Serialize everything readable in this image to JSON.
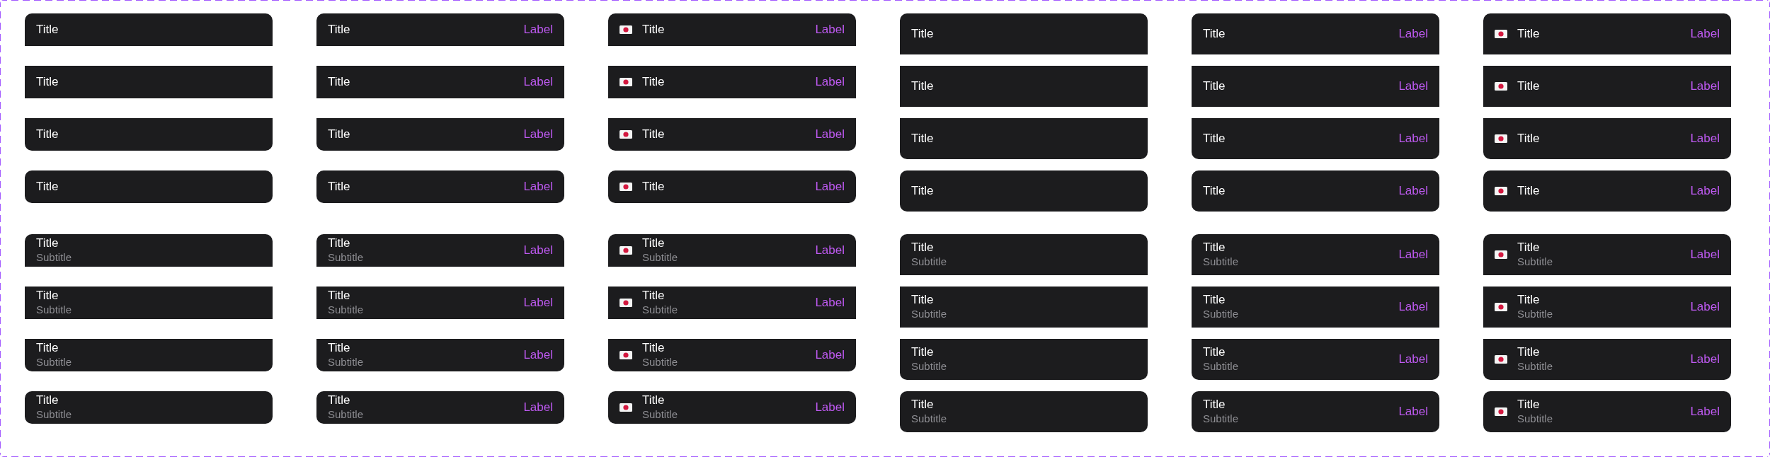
{
  "sections": [
    {
      "rows": [
        {
          "cells": [
            {
              "kind": "plain",
              "tall": false,
              "rounded_top": true,
              "rounded_bottom": false,
              "title": "Title"
            },
            {
              "kind": "plain",
              "tall": false,
              "rounded_top": true,
              "rounded_bottom": false,
              "title": "Title",
              "label": "Label"
            },
            {
              "kind": "flag",
              "tall": false,
              "rounded_top": true,
              "rounded_bottom": false,
              "title": "Title",
              "label": "Label"
            },
            {
              "kind": "plain",
              "tall": true,
              "rounded_top": true,
              "rounded_bottom": false,
              "title": "Title"
            },
            {
              "kind": "plain",
              "tall": true,
              "rounded_top": true,
              "rounded_bottom": false,
              "title": "Title",
              "label": "Label"
            },
            {
              "kind": "flag",
              "tall": true,
              "rounded_top": true,
              "rounded_bottom": false,
              "title": "Title",
              "label": "Label"
            }
          ]
        },
        {
          "cells": [
            {
              "kind": "plain",
              "tall": false,
              "rounded_top": false,
              "rounded_bottom": false,
              "title": "Title"
            },
            {
              "kind": "plain",
              "tall": false,
              "rounded_top": false,
              "rounded_bottom": false,
              "title": "Title",
              "label": "Label"
            },
            {
              "kind": "flag",
              "tall": false,
              "rounded_top": false,
              "rounded_bottom": false,
              "title": "Title",
              "label": "Label"
            },
            {
              "kind": "plain",
              "tall": true,
              "rounded_top": false,
              "rounded_bottom": false,
              "title": "Title"
            },
            {
              "kind": "plain",
              "tall": true,
              "rounded_top": false,
              "rounded_bottom": false,
              "title": "Title",
              "label": "Label"
            },
            {
              "kind": "flag",
              "tall": true,
              "rounded_top": false,
              "rounded_bottom": false,
              "title": "Title",
              "label": "Label"
            }
          ]
        },
        {
          "cells": [
            {
              "kind": "plain",
              "tall": false,
              "rounded_top": false,
              "rounded_bottom": true,
              "title": "Title"
            },
            {
              "kind": "plain",
              "tall": false,
              "rounded_top": false,
              "rounded_bottom": true,
              "title": "Title",
              "label": "Label"
            },
            {
              "kind": "flag",
              "tall": false,
              "rounded_top": false,
              "rounded_bottom": true,
              "title": "Title",
              "label": "Label"
            },
            {
              "kind": "plain",
              "tall": true,
              "rounded_top": false,
              "rounded_bottom": true,
              "title": "Title"
            },
            {
              "kind": "plain",
              "tall": true,
              "rounded_top": false,
              "rounded_bottom": true,
              "title": "Title",
              "label": "Label"
            },
            {
              "kind": "flag",
              "tall": true,
              "rounded_top": false,
              "rounded_bottom": true,
              "title": "Title",
              "label": "Label"
            }
          ]
        },
        {
          "cells": [
            {
              "kind": "plain",
              "tall": false,
              "rounded_top": true,
              "rounded_bottom": true,
              "title": "Title"
            },
            {
              "kind": "plain",
              "tall": false,
              "rounded_top": true,
              "rounded_bottom": true,
              "title": "Title",
              "label": "Label"
            },
            {
              "kind": "flag",
              "tall": false,
              "rounded_top": true,
              "rounded_bottom": true,
              "title": "Title",
              "label": "Label"
            },
            {
              "kind": "plain",
              "tall": true,
              "rounded_top": true,
              "rounded_bottom": true,
              "title": "Title"
            },
            {
              "kind": "plain",
              "tall": true,
              "rounded_top": true,
              "rounded_bottom": true,
              "title": "Title",
              "label": "Label"
            },
            {
              "kind": "flag",
              "tall": true,
              "rounded_top": true,
              "rounded_bottom": true,
              "title": "Title",
              "label": "Label"
            }
          ]
        }
      ]
    },
    {
      "rows": [
        {
          "cells": [
            {
              "kind": "plain",
              "tall": false,
              "rounded_top": true,
              "rounded_bottom": false,
              "title": "Title",
              "subtitle": "Subtitle"
            },
            {
              "kind": "plain",
              "tall": false,
              "rounded_top": true,
              "rounded_bottom": false,
              "title": "Title",
              "subtitle": "Subtitle",
              "label": "Label"
            },
            {
              "kind": "flag",
              "tall": false,
              "rounded_top": true,
              "rounded_bottom": false,
              "title": "Title",
              "subtitle": "Subtitle",
              "label": "Label"
            },
            {
              "kind": "plain",
              "tall": true,
              "rounded_top": true,
              "rounded_bottom": false,
              "title": "Title",
              "subtitle": "Subtitle"
            },
            {
              "kind": "plain",
              "tall": true,
              "rounded_top": true,
              "rounded_bottom": false,
              "title": "Title",
              "subtitle": "Subtitle",
              "label": "Label"
            },
            {
              "kind": "flag",
              "tall": true,
              "rounded_top": true,
              "rounded_bottom": false,
              "title": "Title",
              "subtitle": "Subtitle",
              "label": "Label"
            }
          ]
        },
        {
          "cells": [
            {
              "kind": "plain",
              "tall": false,
              "rounded_top": false,
              "rounded_bottom": false,
              "title": "Title",
              "subtitle": "Subtitle"
            },
            {
              "kind": "plain",
              "tall": false,
              "rounded_top": false,
              "rounded_bottom": false,
              "title": "Title",
              "subtitle": "Subtitle",
              "label": "Label"
            },
            {
              "kind": "flag",
              "tall": false,
              "rounded_top": false,
              "rounded_bottom": false,
              "title": "Title",
              "subtitle": "Subtitle",
              "label": "Label"
            },
            {
              "kind": "plain",
              "tall": true,
              "rounded_top": false,
              "rounded_bottom": false,
              "title": "Title",
              "subtitle": "Subtitle"
            },
            {
              "kind": "plain",
              "tall": true,
              "rounded_top": false,
              "rounded_bottom": false,
              "title": "Title",
              "subtitle": "Subtitle",
              "label": "Label"
            },
            {
              "kind": "flag",
              "tall": true,
              "rounded_top": false,
              "rounded_bottom": false,
              "title": "Title",
              "subtitle": "Subtitle",
              "label": "Label"
            }
          ]
        },
        {
          "cells": [
            {
              "kind": "plain",
              "tall": false,
              "rounded_top": false,
              "rounded_bottom": true,
              "title": "Title",
              "subtitle": "Subtitle"
            },
            {
              "kind": "plain",
              "tall": false,
              "rounded_top": false,
              "rounded_bottom": true,
              "title": "Title",
              "subtitle": "Subtitle",
              "label": "Label"
            },
            {
              "kind": "flag",
              "tall": false,
              "rounded_top": false,
              "rounded_bottom": true,
              "title": "Title",
              "subtitle": "Subtitle",
              "label": "Label"
            },
            {
              "kind": "plain",
              "tall": true,
              "rounded_top": false,
              "rounded_bottom": true,
              "title": "Title",
              "subtitle": "Subtitle"
            },
            {
              "kind": "plain",
              "tall": true,
              "rounded_top": false,
              "rounded_bottom": true,
              "title": "Title",
              "subtitle": "Subtitle",
              "label": "Label"
            },
            {
              "kind": "flag",
              "tall": true,
              "rounded_top": false,
              "rounded_bottom": true,
              "title": "Title",
              "subtitle": "Subtitle",
              "label": "Label"
            }
          ]
        },
        {
          "cells": [
            {
              "kind": "plain",
              "tall": false,
              "rounded_top": true,
              "rounded_bottom": true,
              "title": "Title",
              "subtitle": "Subtitle"
            },
            {
              "kind": "plain",
              "tall": false,
              "rounded_top": true,
              "rounded_bottom": true,
              "title": "Title",
              "subtitle": "Subtitle",
              "label": "Label"
            },
            {
              "kind": "flag",
              "tall": false,
              "rounded_top": true,
              "rounded_bottom": true,
              "title": "Title",
              "subtitle": "Subtitle",
              "label": "Label"
            },
            {
              "kind": "plain",
              "tall": true,
              "rounded_top": true,
              "rounded_bottom": true,
              "title": "Title",
              "subtitle": "Subtitle"
            },
            {
              "kind": "plain",
              "tall": true,
              "rounded_top": true,
              "rounded_bottom": true,
              "title": "Title",
              "subtitle": "Subtitle",
              "label": "Label"
            },
            {
              "kind": "flag",
              "tall": true,
              "rounded_top": true,
              "rounded_bottom": true,
              "title": "Title",
              "subtitle": "Subtitle",
              "label": "Label"
            }
          ]
        }
      ]
    }
  ]
}
